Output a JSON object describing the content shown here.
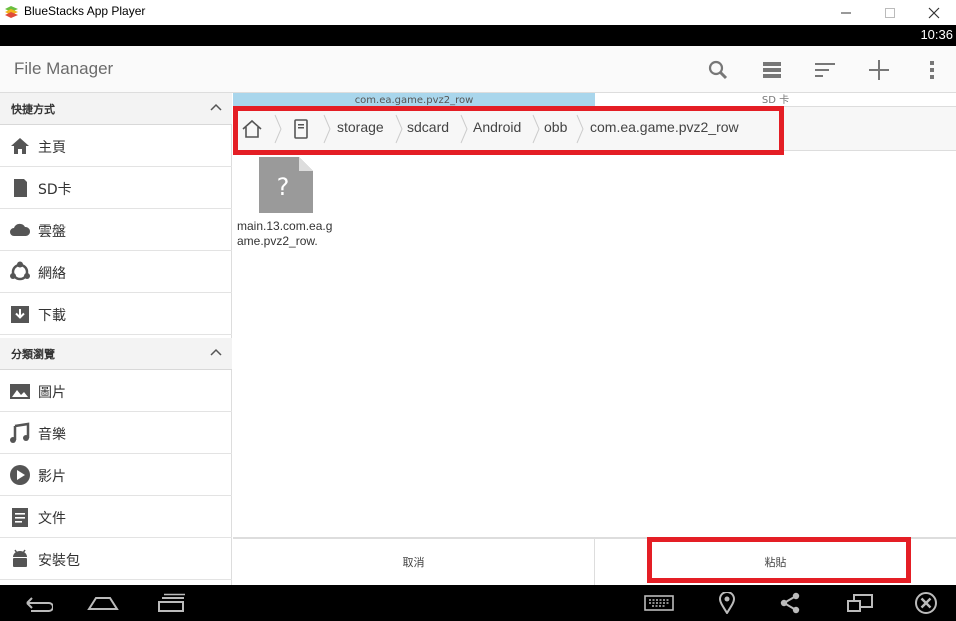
{
  "window": {
    "title": "BlueStacks App Player",
    "minimize_icon": "minimize-icon",
    "maximize_icon": "maximize-icon",
    "close_icon": "close-icon"
  },
  "status_bar": {
    "time": "10:36"
  },
  "action_bar": {
    "title": "File Manager",
    "icons": [
      "search-icon",
      "storage-icon",
      "sort-icon",
      "add-icon",
      "overflow-menu-icon"
    ]
  },
  "sidebar": {
    "sections": [
      {
        "header": "快捷方式",
        "items": [
          {
            "label": "主頁",
            "icon": "home-icon"
          },
          {
            "label": "SD卡",
            "icon": "sd-card-icon"
          },
          {
            "label": "雲盤",
            "icon": "cloud-icon"
          },
          {
            "label": "網絡",
            "icon": "network-icon"
          },
          {
            "label": "下載",
            "icon": "download-icon"
          }
        ]
      },
      {
        "header": "分類瀏覽",
        "items": [
          {
            "label": "圖片",
            "icon": "image-icon"
          },
          {
            "label": "音樂",
            "icon": "music-icon"
          },
          {
            "label": "影片",
            "icon": "video-icon"
          },
          {
            "label": "文件",
            "icon": "document-icon"
          },
          {
            "label": "安裝包",
            "icon": "android-package-icon"
          }
        ]
      }
    ]
  },
  "tabs": [
    {
      "label": "com.ea.game.pvz2_row",
      "active": true
    },
    {
      "label": "SD 卡",
      "active": false
    }
  ],
  "breadcrumb": [
    "storage",
    "sdcard",
    "Android",
    "obb",
    "com.ea.game.pvz2_row"
  ],
  "files": [
    {
      "name": "main.13.com.ea.game.pvz2_row.",
      "icon": "unknown-file-icon"
    }
  ],
  "actions": {
    "cancel": "取消",
    "paste": "粘貼"
  },
  "nav_bar": {
    "icons": [
      "back-icon",
      "home-icon",
      "recents-icon",
      "keyboard-icon",
      "location-icon",
      "share-icon",
      "multi-window-icon",
      "close-app-icon"
    ]
  },
  "colors": {
    "highlight": "#e41e25",
    "active_tab": "#a9d6ec"
  }
}
